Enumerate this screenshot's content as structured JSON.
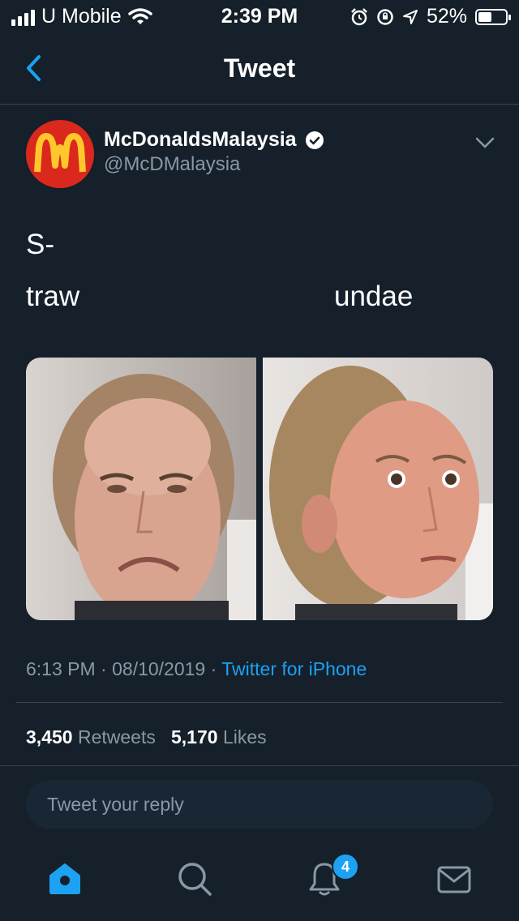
{
  "status_bar": {
    "carrier": "U Mobile",
    "time": "2:39 PM",
    "battery": "52%",
    "battery_level": 0.52
  },
  "header": {
    "title": "Tweet"
  },
  "tweet": {
    "author_name": "McDonaldsMalaysia",
    "author_handle": "@McDMalaysia",
    "verified": true,
    "text_line1": "S-",
    "text_word_left": "traw",
    "text_word_right": "undae",
    "photos": [
      "photo-disgusted-face",
      "photo-curious-face"
    ],
    "time": "6:13 PM",
    "date": "08/10/2019",
    "dot": "·",
    "source": "Twitter for iPhone",
    "retweet_count": "3,450",
    "retweet_label": "Retweets",
    "like_count": "5,170",
    "like_label": "Likes"
  },
  "reply": {
    "placeholder": "Tweet your reply"
  },
  "tabbar": {
    "items": [
      "home-icon",
      "search-icon",
      "notifications-icon",
      "messages-icon"
    ],
    "notifications_badge": "4"
  },
  "colors": {
    "background": "#15202b",
    "accent": "#1da1f2",
    "muted": "#8899a6",
    "divider": "#38444d",
    "mcdonalds_red": "#da291c",
    "mcdonalds_yellow": "#ffc72c"
  }
}
